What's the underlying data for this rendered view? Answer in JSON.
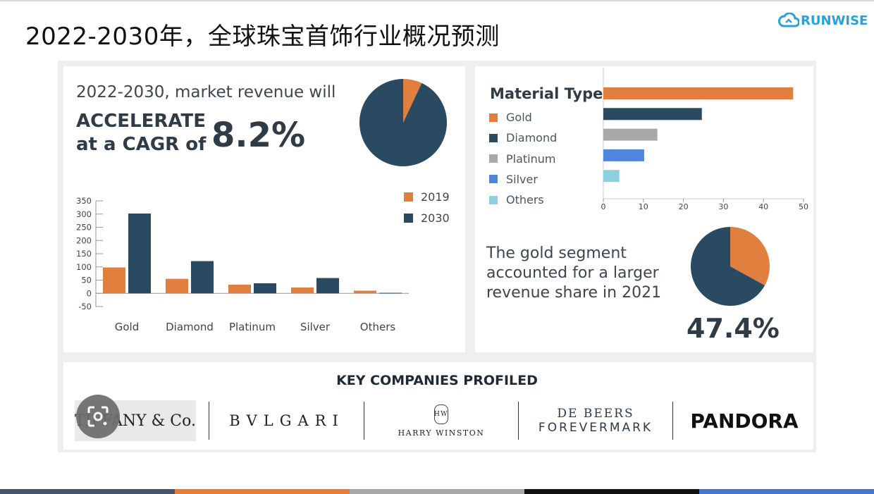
{
  "slide": {
    "title": "2022-2030年，全球珠宝首饰行业概况预测",
    "brand": "RUNWISE"
  },
  "cagr": {
    "line1": "2022-2030, market revenue will",
    "line2": "ACCELERATE",
    "line3": "at a CAGR of",
    "value": "8.2%"
  },
  "gold_share": {
    "line1": "The gold segment",
    "line2": "accounted for a larger",
    "line3": "revenue share in 2021",
    "value": "47.4%"
  },
  "material_legend_title": "Material Type",
  "companies": {
    "title": "KEY COMPANIES PROFILED",
    "items": [
      {
        "name": "TIFFANY & Co."
      },
      {
        "name": "BVLGARI"
      },
      {
        "name": "HARRY WINSTON"
      },
      {
        "name": "DE BEERS",
        "sub": "FOREVERMARK"
      },
      {
        "name": "PANDORA"
      }
    ]
  },
  "colors": {
    "orange": "#e07f3e",
    "navy": "#2a4a62",
    "gray": "#a8a8a8",
    "blue": "#4f86d9",
    "lightblue": "#8fd0e0"
  },
  "chart_data": [
    {
      "type": "pie",
      "values": [
        7,
        93
      ],
      "colors": [
        "#e07f3e",
        "#2a4a62"
      ]
    },
    {
      "type": "bar",
      "orientation": "horizontal",
      "title": "Material Type",
      "categories": [
        "Gold",
        "Diamond",
        "Platinum",
        "Silver",
        "Others"
      ],
      "values": [
        47.4,
        24.6,
        13.5,
        10.2,
        4
      ],
      "colors": [
        "#e07f3e",
        "#2a4a62",
        "#a8a8a8",
        "#4f86d9",
        "#8fd0e0"
      ],
      "xlim": [
        0,
        50
      ],
      "xticks": [
        0,
        10,
        20,
        30,
        40,
        50
      ],
      "legend": "left"
    },
    {
      "type": "bar",
      "categories": [
        "Gold",
        "Diamond",
        "Platinum",
        "Silver",
        "Others"
      ],
      "series": [
        {
          "name": "2019",
          "values": [
            98,
            55,
            33,
            22,
            10
          ],
          "color": "#e07f3e"
        },
        {
          "name": "2030",
          "values": [
            302,
            122,
            38,
            58,
            2
          ],
          "color": "#2a4a62"
        }
      ],
      "ylim": [
        -50,
        350
      ],
      "yticks": [
        350,
        300,
        250,
        200,
        150,
        100,
        50,
        0,
        -50
      ],
      "legend": "top-right"
    },
    {
      "type": "pie",
      "values": [
        33,
        67
      ],
      "colors": [
        "#e07f3e",
        "#2a4a62"
      ]
    }
  ]
}
